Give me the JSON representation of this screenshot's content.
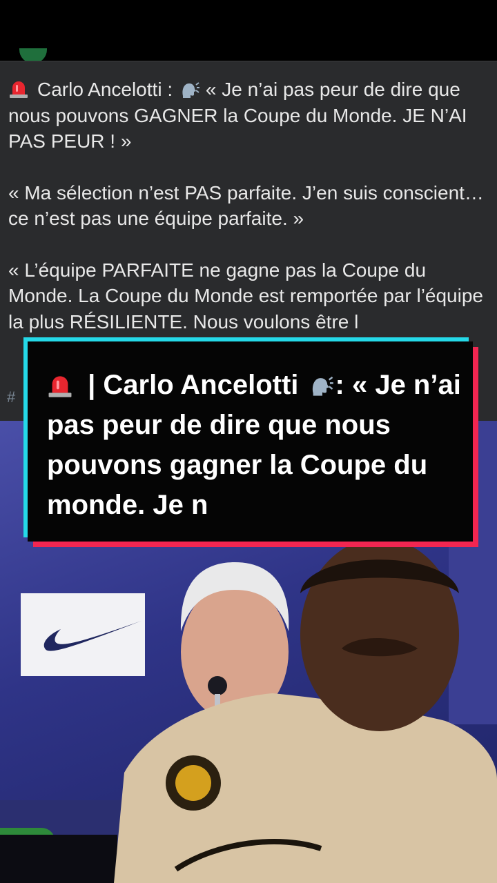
{
  "post": {
    "paragraphs": [
      "Carlo Ancelotti : ",
      "« Je n’ai pas peur de dire que nous pouvons GAGNER la Coupe du Monde. JE N’AI PAS PEUR ! »",
      "« Ma sélection n’est PAS parfaite. J’en suis conscient… ce n’est pas une équipe parfaite. »",
      "« L’équipe PARFAITE ne gagne pas la Coupe du Monde. La Coupe du Monde est remportée par l’équipe la plus RÉSILIENTE. Nous voulons être l"
    ],
    "hashtag": "#"
  },
  "caption": {
    "prefix": " | Carlo Ancelotti ",
    "text": ": « Je n’ai pas peur de dire que nous pouvons gagner la Coupe du monde. Je n"
  },
  "icons": {
    "siren": "siren-emoji-icon",
    "speaking": "speaking-head-icon"
  },
  "colors": {
    "caption_cyan": "#25d9e8",
    "caption_red": "#f22651",
    "post_bg": "#2a2b2d"
  }
}
